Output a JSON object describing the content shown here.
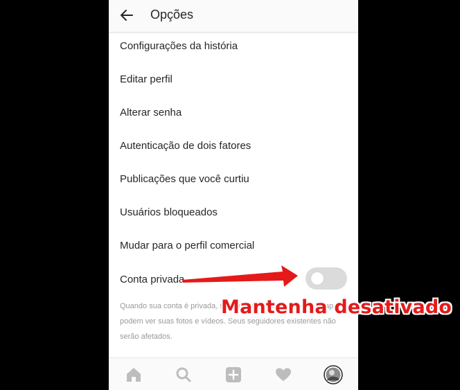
{
  "header": {
    "title": "Opções",
    "back_icon": "arrow-left-icon"
  },
  "menu": {
    "items": [
      {
        "label": "Configurações da história"
      },
      {
        "label": "Editar perfil"
      },
      {
        "label": "Alterar senha"
      },
      {
        "label": "Autenticação de dois fatores"
      },
      {
        "label": "Publicações que você curtiu"
      },
      {
        "label": "Usuários bloqueados"
      },
      {
        "label": "Mudar para o perfil comercial"
      }
    ]
  },
  "private_account": {
    "label": "Conta privada",
    "enabled": false,
    "description": "Quando sua conta é privada, somente as pessoas que você aprova podem ver suas fotos e vídeos. Seus seguidores existentes não serão afetados."
  },
  "annotation": {
    "text": "Mantenha desativado",
    "color": "#e41a1a"
  },
  "tabbar": {
    "icons": [
      "home-icon",
      "search-icon",
      "add-post-icon",
      "activity-heart-icon",
      "profile-avatar-icon"
    ]
  }
}
